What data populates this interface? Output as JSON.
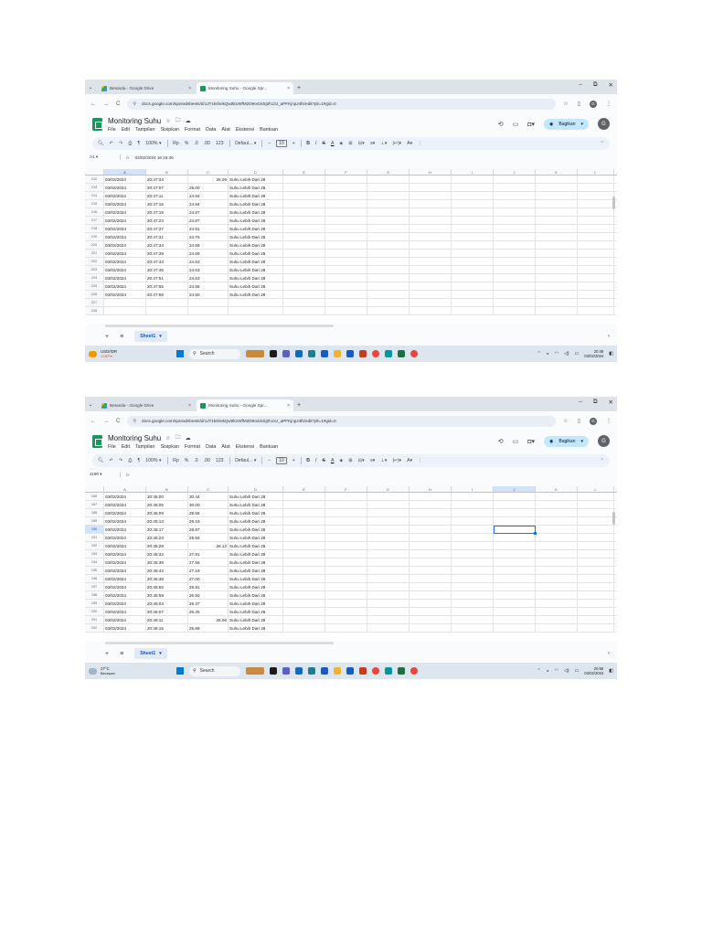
{
  "screenshots": [
    {
      "browser": {
        "tabs": [
          {
            "label": "Beranda - Google Drive",
            "icon": "google-drive-icon",
            "active": false
          },
          {
            "label": "Monitoring Suhu - Google Spr...",
            "icon": "google-sheets-icon",
            "active": true
          }
        ],
        "url": "docs.google.com/spreadsheets/d/1JT1kshekQwttk1WfM2D9o43c5j2h13J_aPFKjnpJ4fs/edit?pli=1#gid=0"
      },
      "app": {
        "title": "Monitoring Suhu",
        "menus": [
          "File",
          "Edit",
          "Tampilan",
          "Sisipkan",
          "Format",
          "Data",
          "Alat",
          "Ekstensi",
          "Bantuan"
        ],
        "share_label": "Bagikan",
        "avatar_letter": "G"
      },
      "toolbar": {
        "zoom": "100%",
        "currency": "Rp",
        "percent": "%",
        "dec_less": ".0",
        "dec_more": ".00",
        "num_format": "123",
        "font": "Defaul...",
        "font_size": "10"
      },
      "formula_bar": {
        "cell_ref": "A1",
        "fx": "fx",
        "value": "03/02/2024 16:15:46"
      },
      "columns": [
        "A",
        "B",
        "C",
        "D",
        "E",
        "F",
        "G",
        "H",
        "I",
        "J",
        "K",
        "L"
      ],
      "selected_column": "A",
      "selected_row": "",
      "rows": [
        {
          "n": "212",
          "a": "03/02/2024",
          "b": "20:47:03",
          "c": "",
          "c_right": "25.06",
          "d": "Suhu Lebih Dari 28"
        },
        {
          "n": "213",
          "a": "03/02/2024",
          "b": "20:47:07",
          "c": "25.00",
          "c_right": "",
          "d": "Suhu Lebih Dari 28"
        },
        {
          "n": "214",
          "a": "03/02/2024",
          "b": "20:47:11",
          "c": "24.94",
          "c_right": "",
          "d": "Suhu Lebih Dari 28"
        },
        {
          "n": "215",
          "a": "03/02/2024",
          "b": "20:47:15",
          "c": "24.94",
          "c_right": "",
          "d": "Suhu Lebih Dari 28"
        },
        {
          "n": "216",
          "a": "03/02/2024",
          "b": "20:47:19",
          "c": "24.87",
          "c_right": "",
          "d": "Suhu Lebih Dari 28"
        },
        {
          "n": "217",
          "a": "03/02/2024",
          "b": "20:47:23",
          "c": "24.87",
          "c_right": "",
          "d": "Suhu Lebih Dari 28"
        },
        {
          "n": "218",
          "a": "03/02/2024",
          "b": "20:47:27",
          "c": "24.81",
          "c_right": "",
          "d": "Suhu Lebih Dari 28"
        },
        {
          "n": "219",
          "a": "03/02/2024",
          "b": "20:47:31",
          "c": "24.75",
          "c_right": "",
          "d": "Suhu Lebih Dari 28"
        },
        {
          "n": "220",
          "a": "03/02/2024",
          "b": "20:47:34",
          "c": "24.69",
          "c_right": "",
          "d": "Suhu Lebih Dari 28"
        },
        {
          "n": "221",
          "a": "03/02/2024",
          "b": "20:47:39",
          "c": "24.69",
          "c_right": "",
          "d": "Suhu Lebih Dari 28"
        },
        {
          "n": "222",
          "a": "03/02/2024",
          "b": "20:47:43",
          "c": "24.63",
          "c_right": "",
          "d": "Suhu Lebih Dari 28"
        },
        {
          "n": "223",
          "a": "03/02/2024",
          "b": "20:47:46",
          "c": "24.63",
          "c_right": "",
          "d": "Suhu Lebih Dari 28"
        },
        {
          "n": "224",
          "a": "03/02/2024",
          "b": "20:47:51",
          "c": "24.63",
          "c_right": "",
          "d": "Suhu Lebih Dari 28"
        },
        {
          "n": "225",
          "a": "03/02/2024",
          "b": "20:47:55",
          "c": "24.56",
          "c_right": "",
          "d": "Suhu Lebih Dari 28"
        },
        {
          "n": "226",
          "a": "03/02/2024",
          "b": "20:47:59",
          "c": "24.50",
          "c_right": "",
          "d": "Suhu Lebih Dari 28"
        },
        {
          "n": "227",
          "a": "",
          "b": "",
          "c": "",
          "c_right": "",
          "d": ""
        },
        {
          "n": "228",
          "a": "",
          "b": "",
          "c": "",
          "c_right": "",
          "d": ""
        }
      ],
      "sheet_tab": "Sheet1",
      "taskbar": {
        "widget_title": "USD/IDR",
        "widget_sub": "-0.87%",
        "widget_sub_color": "#d93025",
        "search": "Search",
        "time": "20:48",
        "date": "03/02/2024"
      }
    },
    {
      "browser": {
        "tabs": [
          {
            "label": "Beranda - Google Drive",
            "icon": "google-drive-icon",
            "active": false
          },
          {
            "label": "Monitoring Suhu - Google Spr...",
            "icon": "google-sheets-icon",
            "active": true
          }
        ],
        "url": "docs.google.com/spreadsheets/d/1JT1kshekQwttk1WfM2D9o43c5j2h13J_aPFKjnpJ4fs/edit?pli=1#gid=0"
      },
      "app": {
        "title": "Monitoring Suhu",
        "menus": [
          "File",
          "Edit",
          "Tampilan",
          "Sisipkan",
          "Format",
          "Data",
          "Alat",
          "Ekstensi",
          "Bantuan"
        ],
        "share_label": "Bagikan",
        "avatar_letter": "G"
      },
      "toolbar": {
        "zoom": "100%",
        "currency": "Rp",
        "percent": "%",
        "dec_less": ".0",
        "dec_more": ".00",
        "num_format": "123",
        "font": "Defaul...",
        "font_size": "10"
      },
      "formula_bar": {
        "cell_ref": "J190",
        "fx": "fx",
        "value": ""
      },
      "columns": [
        "A",
        "B",
        "C",
        "D",
        "E",
        "F",
        "G",
        "H",
        "I",
        "J",
        "K",
        "L"
      ],
      "selected_column": "J",
      "selected_row": "190",
      "rows": [
        {
          "n": "186",
          "a": "03/02/2024",
          "b": "20:45:00",
          "c": "30.44",
          "c_right": "",
          "d": "Suhu Lebih Dari 28"
        },
        {
          "n": "187",
          "a": "03/02/2024",
          "b": "20:45:05",
          "c": "30.00",
          "c_right": "",
          "d": "Suhu Lebih Dari 28"
        },
        {
          "n": "188",
          "a": "03/02/2024",
          "b": "20:45:09",
          "c": "29.56",
          "c_right": "",
          "d": "Suhu Lebih Dari 28"
        },
        {
          "n": "189",
          "a": "03/02/2024",
          "b": "20:45:13",
          "c": "29.19",
          "c_right": "",
          "d": "Suhu Lebih Dari 28"
        },
        {
          "n": "190",
          "a": "03/02/2024",
          "b": "20:45:17",
          "c": "28.87",
          "c_right": "",
          "d": "Suhu Lebih Dari 28"
        },
        {
          "n": "191",
          "a": "03/02/2024",
          "b": "20:45:23",
          "c": "28.56",
          "c_right": "",
          "d": "Suhu Lebih Dari 28"
        },
        {
          "n": "192",
          "a": "03/02/2024",
          "b": "20:45:28",
          "c": "",
          "c_right": "28.12",
          "d": "Suhu Lebih Dari 28"
        },
        {
          "n": "193",
          "a": "03/02/2024",
          "b": "20:45:32",
          "c": "27.81",
          "c_right": "",
          "d": "Suhu Lebih Dari 28"
        },
        {
          "n": "194",
          "a": "03/02/2024",
          "b": "20:45:39",
          "c": "27.56",
          "c_right": "",
          "d": "Suhu Lebih Dari 28"
        },
        {
          "n": "195",
          "a": "03/02/2024",
          "b": "20:45:43",
          "c": "27.19",
          "c_right": "",
          "d": "Suhu Lebih Dari 28"
        },
        {
          "n": "196",
          "a": "03/02/2024",
          "b": "20:45:48",
          "c": "27.00",
          "c_right": "",
          "d": "Suhu Lebih Dari 28"
        },
        {
          "n": "197",
          "a": "03/02/2024",
          "b": "20:45:55",
          "c": "26.81",
          "c_right": "",
          "d": "Suhu Lebih Dari 28"
        },
        {
          "n": "198",
          "a": "03/02/2024",
          "b": "20:45:59",
          "c": "26.50",
          "c_right": "",
          "d": "Suhu Lebih Dari 28"
        },
        {
          "n": "199",
          "a": "03/02/2024",
          "b": "20:46:03",
          "c": "26.37",
          "c_right": "",
          "d": "Suhu Lebih Dari 28"
        },
        {
          "n": "200",
          "a": "03/02/2024",
          "b": "20:46:07",
          "c": "26.25",
          "c_right": "",
          "d": "Suhu Lebih Dari 28"
        },
        {
          "n": "201",
          "a": "03/02/2024",
          "b": "20:46:11",
          "c": "",
          "c_right": "26.06",
          "d": "Suhu Lebih Dari 28"
        },
        {
          "n": "202",
          "a": "03/02/2024",
          "b": "20:46:15",
          "c": "25.88",
          "c_right": "",
          "d": "Suhu Lebih Dari 28"
        }
      ],
      "sheet_tab": "Sheet1",
      "taskbar": {
        "widget_title": "27°C",
        "widget_sub": "Berawan",
        "widget_sub_color": "#222222",
        "search": "Search",
        "time": "20:56",
        "date": "03/02/2024"
      }
    }
  ]
}
